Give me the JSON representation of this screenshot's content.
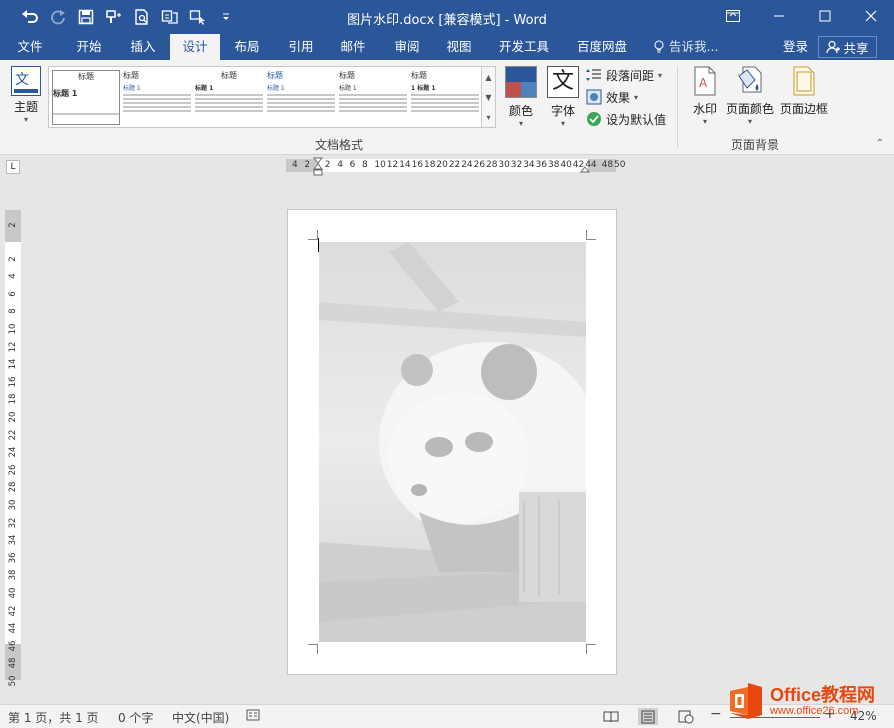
{
  "window": {
    "title": "图片水印.docx [兼容模式] - Word",
    "controls": [
      "ribbon-display-options",
      "minimize",
      "maximize",
      "close"
    ]
  },
  "quick_access": [
    "undo-icon",
    "redo-icon",
    "save-icon",
    "format-painter-icon",
    "print-preview-icon",
    "touch-mode-icon",
    "customize-icon",
    "more-icon"
  ],
  "tabs": [
    {
      "label": "文件",
      "active": false
    },
    {
      "label": "开始",
      "active": false
    },
    {
      "label": "插入",
      "active": false
    },
    {
      "label": "设计",
      "active": true
    },
    {
      "label": "布局",
      "active": false
    },
    {
      "label": "引用",
      "active": false
    },
    {
      "label": "邮件",
      "active": false
    },
    {
      "label": "审阅",
      "active": false
    },
    {
      "label": "视图",
      "active": false
    },
    {
      "label": "开发工具",
      "active": false
    },
    {
      "label": "百度网盘",
      "active": false
    }
  ],
  "tell_me": "告诉我...",
  "login": "登录",
  "share": "共享",
  "ribbon": {
    "theme_label": "主题",
    "gallery": {
      "items": [
        {
          "title": "标题",
          "sub": "标题 1"
        },
        {
          "title": "标题",
          "sub": "标题 1"
        },
        {
          "title": "标题",
          "sub": "标题 1"
        },
        {
          "title": "标题",
          "sub": "标题 1"
        },
        {
          "title": "标题",
          "sub": "标题 1"
        },
        {
          "title": "标题",
          "sub": "1 标题 1"
        }
      ]
    },
    "doc_format_label": "文档格式",
    "colors_label": "颜色",
    "fonts_label": "字体",
    "font_glyph": "文",
    "paragraph_spacing_label": "段落间距",
    "effects_label": "效果",
    "set_default_label": "设为默认值",
    "watermark_label": "水印",
    "page_color_label": "页面颜色",
    "page_border_label": "页面边框",
    "page_background_label": "页面背景"
  },
  "hruler_numbers": [
    "4",
    "2",
    "2",
    "4",
    "6",
    "8",
    "10",
    "12",
    "14",
    "16",
    "18",
    "20",
    "22",
    "24",
    "26",
    "28",
    "30",
    "32",
    "34",
    "36",
    "38",
    "40",
    "42",
    "44",
    "48",
    "50"
  ],
  "vruler_numbers": [
    "2",
    "2",
    "4",
    "6",
    "8",
    "10",
    "12",
    "14",
    "16",
    "18",
    "20",
    "22",
    "24",
    "26",
    "28",
    "30",
    "32",
    "34",
    "36",
    "38",
    "40",
    "42",
    "44",
    "46",
    "48",
    "50"
  ],
  "statusbar": {
    "page": "第 1 页，共 1 页",
    "words": "0 个字",
    "language": "中文(中国)",
    "zoom": "42%"
  },
  "logo": {
    "main": "Office教程网",
    "sub": "www.office26.com"
  },
  "colors": {
    "brand": "#2b579a",
    "ribbon": "#f3f3f3",
    "logo": "#e8480e"
  }
}
